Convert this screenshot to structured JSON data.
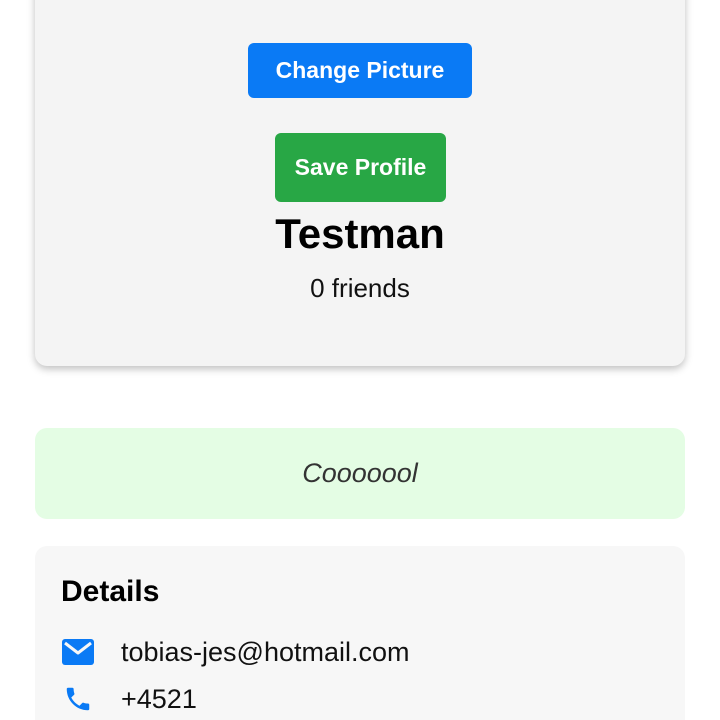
{
  "profile": {
    "change_picture_label": "Change Picture",
    "save_profile_label": "Save Profile",
    "username": "Testman",
    "friends_count": "0 friends"
  },
  "status": {
    "text": "Cooooool"
  },
  "details": {
    "title": "Details",
    "email": "tobias-jes@hotmail.com",
    "phone": "+4521",
    "email_icon": "mail-icon",
    "phone_icon": "phone-icon"
  },
  "colors": {
    "primary_blue": "#0a7af5",
    "save_green": "#28a745",
    "status_background": "#e4fde4",
    "card_background": "#f4f4f4"
  }
}
